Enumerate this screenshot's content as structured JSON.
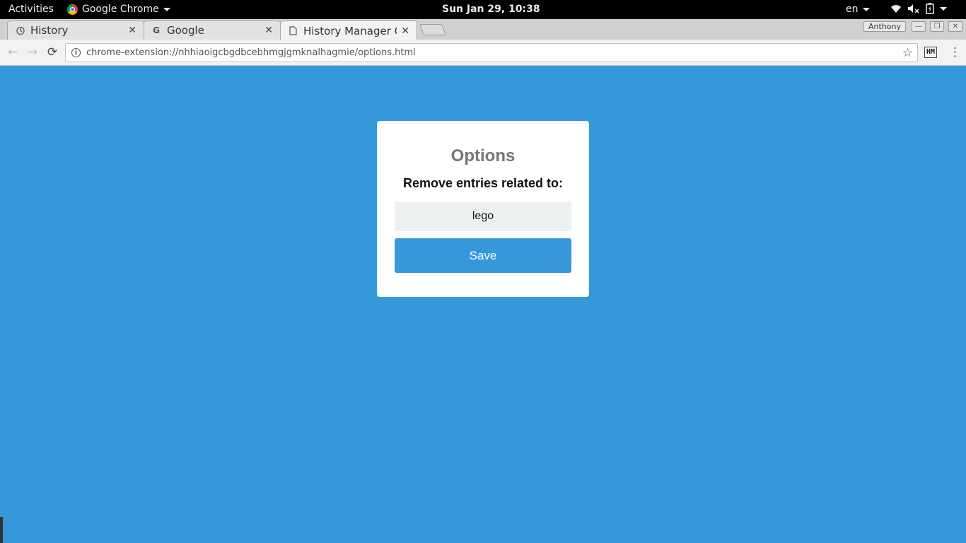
{
  "system_bar": {
    "activities": "Activities",
    "app_name": "Google Chrome",
    "clock": "Sun Jan 29, 10:38",
    "language": "en"
  },
  "browser": {
    "tabs": [
      {
        "title": "History",
        "icon": "history-icon",
        "active": false
      },
      {
        "title": "Google",
        "icon": "google-icon",
        "active": false
      },
      {
        "title": "History Manager Op",
        "icon": "page-icon",
        "active": true
      }
    ],
    "profile_name": "Anthony",
    "url": "chrome-extension://nhhiaoigcbgdbcebhmgjgmknalhagmie/options.html",
    "extension_label": "HM"
  },
  "options_page": {
    "title": "Options",
    "prompt": "Remove entries related to:",
    "input_value": "lego",
    "save_label": "Save"
  },
  "colors": {
    "page_background": "#3598db",
    "button_background": "#3598db",
    "input_background": "#ecf0f1",
    "title_color": "#767676"
  }
}
